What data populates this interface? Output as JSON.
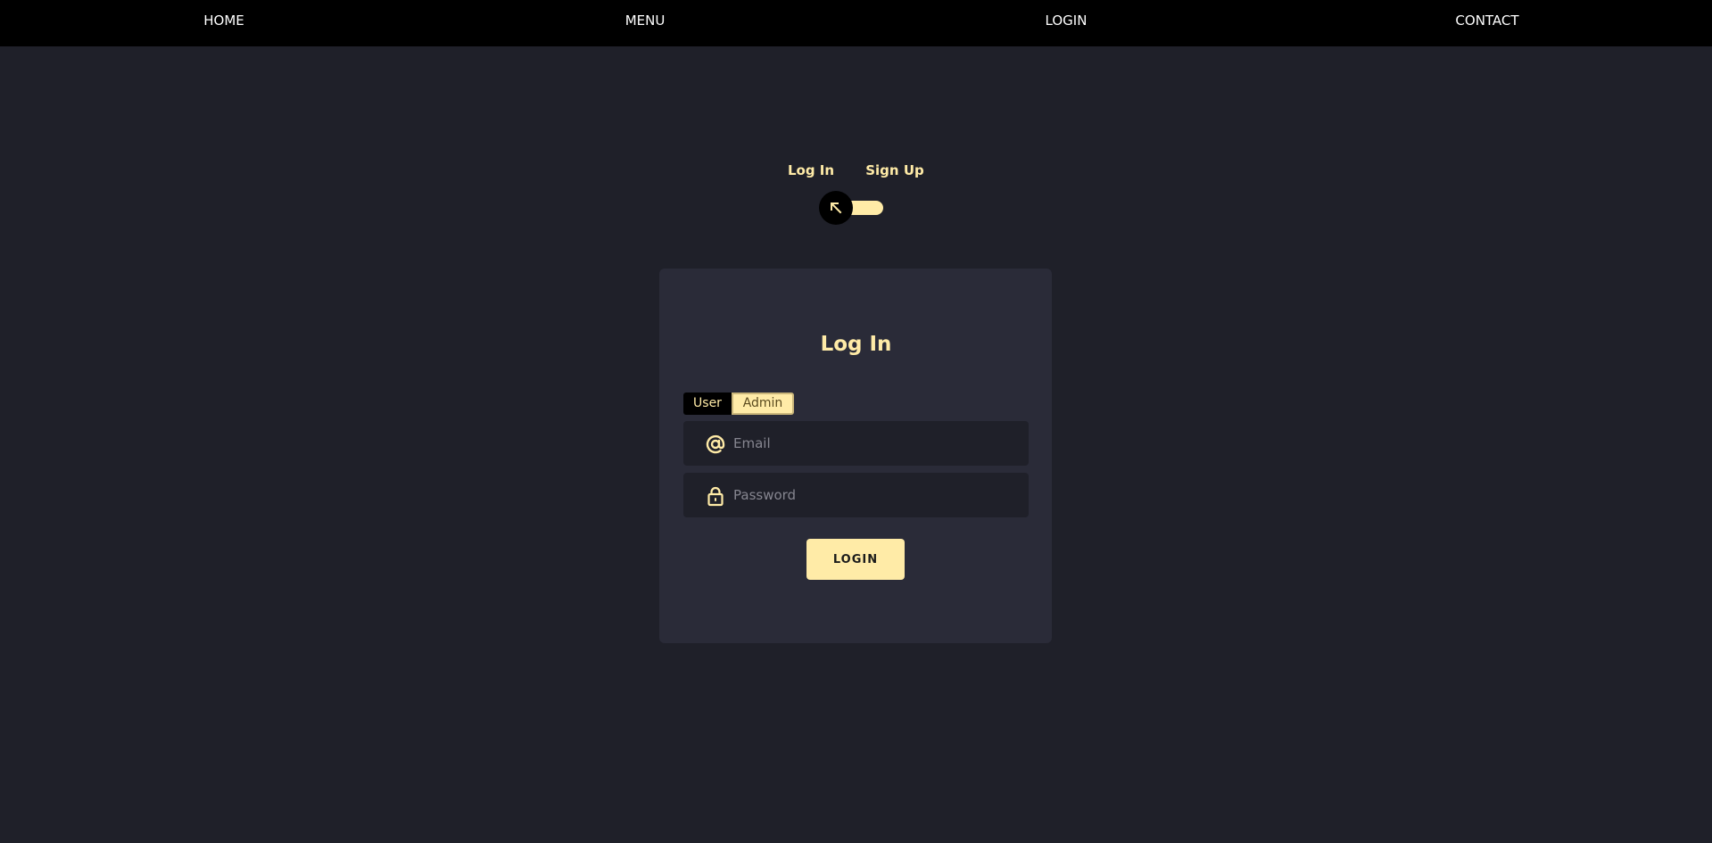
{
  "nav": {
    "items": [
      {
        "label": "HOME"
      },
      {
        "label": "MENU"
      },
      {
        "label": "LOGIN"
      },
      {
        "label": "CONTACT"
      }
    ]
  },
  "switcher": {
    "login_label": "Log In",
    "signup_label": "Sign Up",
    "toggle_icon": "arrow-up-left-icon",
    "checked": false
  },
  "form": {
    "title": "Log In",
    "roles": [
      {
        "label": "User",
        "selected": true
      },
      {
        "label": "Admin",
        "selected": false
      }
    ],
    "email": {
      "placeholder": "Email",
      "value": "",
      "icon": "at-sign-icon"
    },
    "password": {
      "placeholder": "Password",
      "value": "",
      "icon": "lock-icon"
    },
    "submit_label": "LOGIN"
  },
  "colors": {
    "background": "#1f2029",
    "card": "#2a2b38",
    "accent": "#ffeba7",
    "nav": "#000000"
  }
}
